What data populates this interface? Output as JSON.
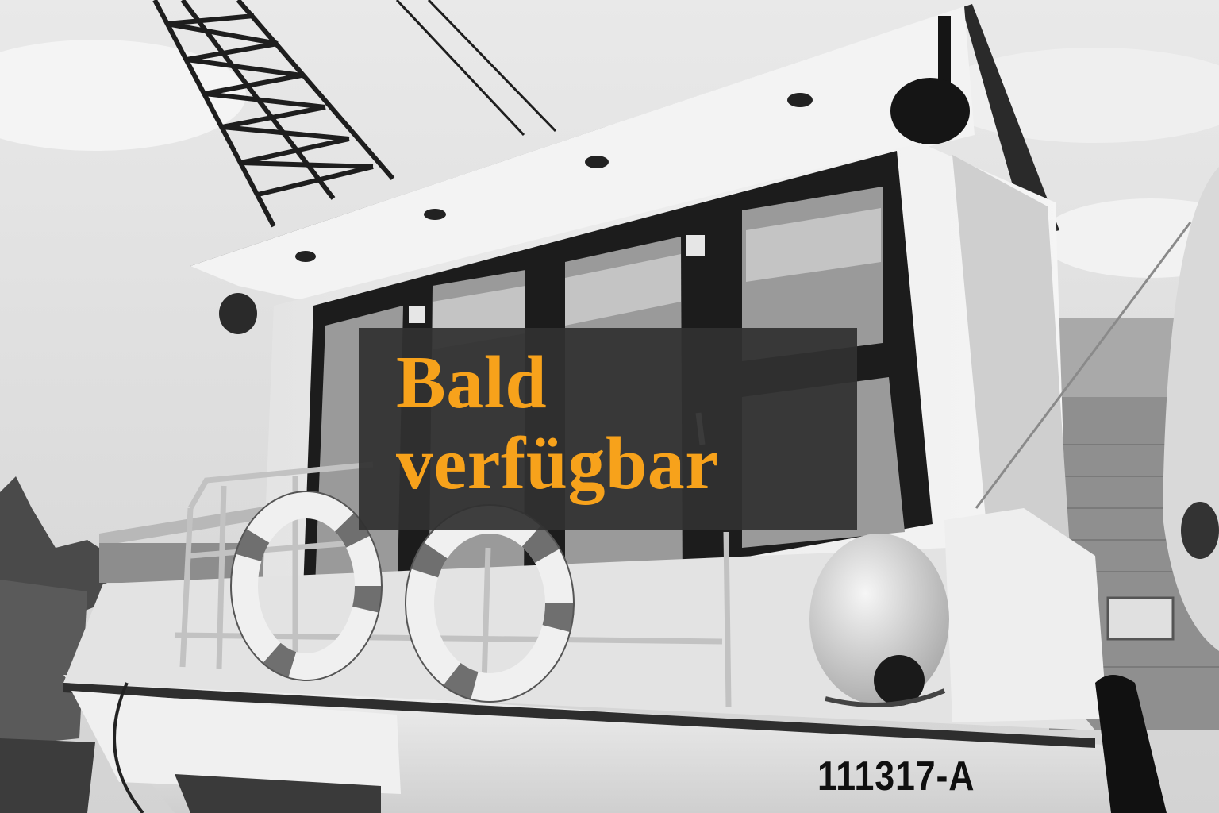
{
  "overlay": {
    "line1": "Bald",
    "line2": "verfügbar",
    "text_color": "#f7a21b",
    "background_color": "#303030"
  },
  "boat": {
    "registration": "111317-A"
  }
}
